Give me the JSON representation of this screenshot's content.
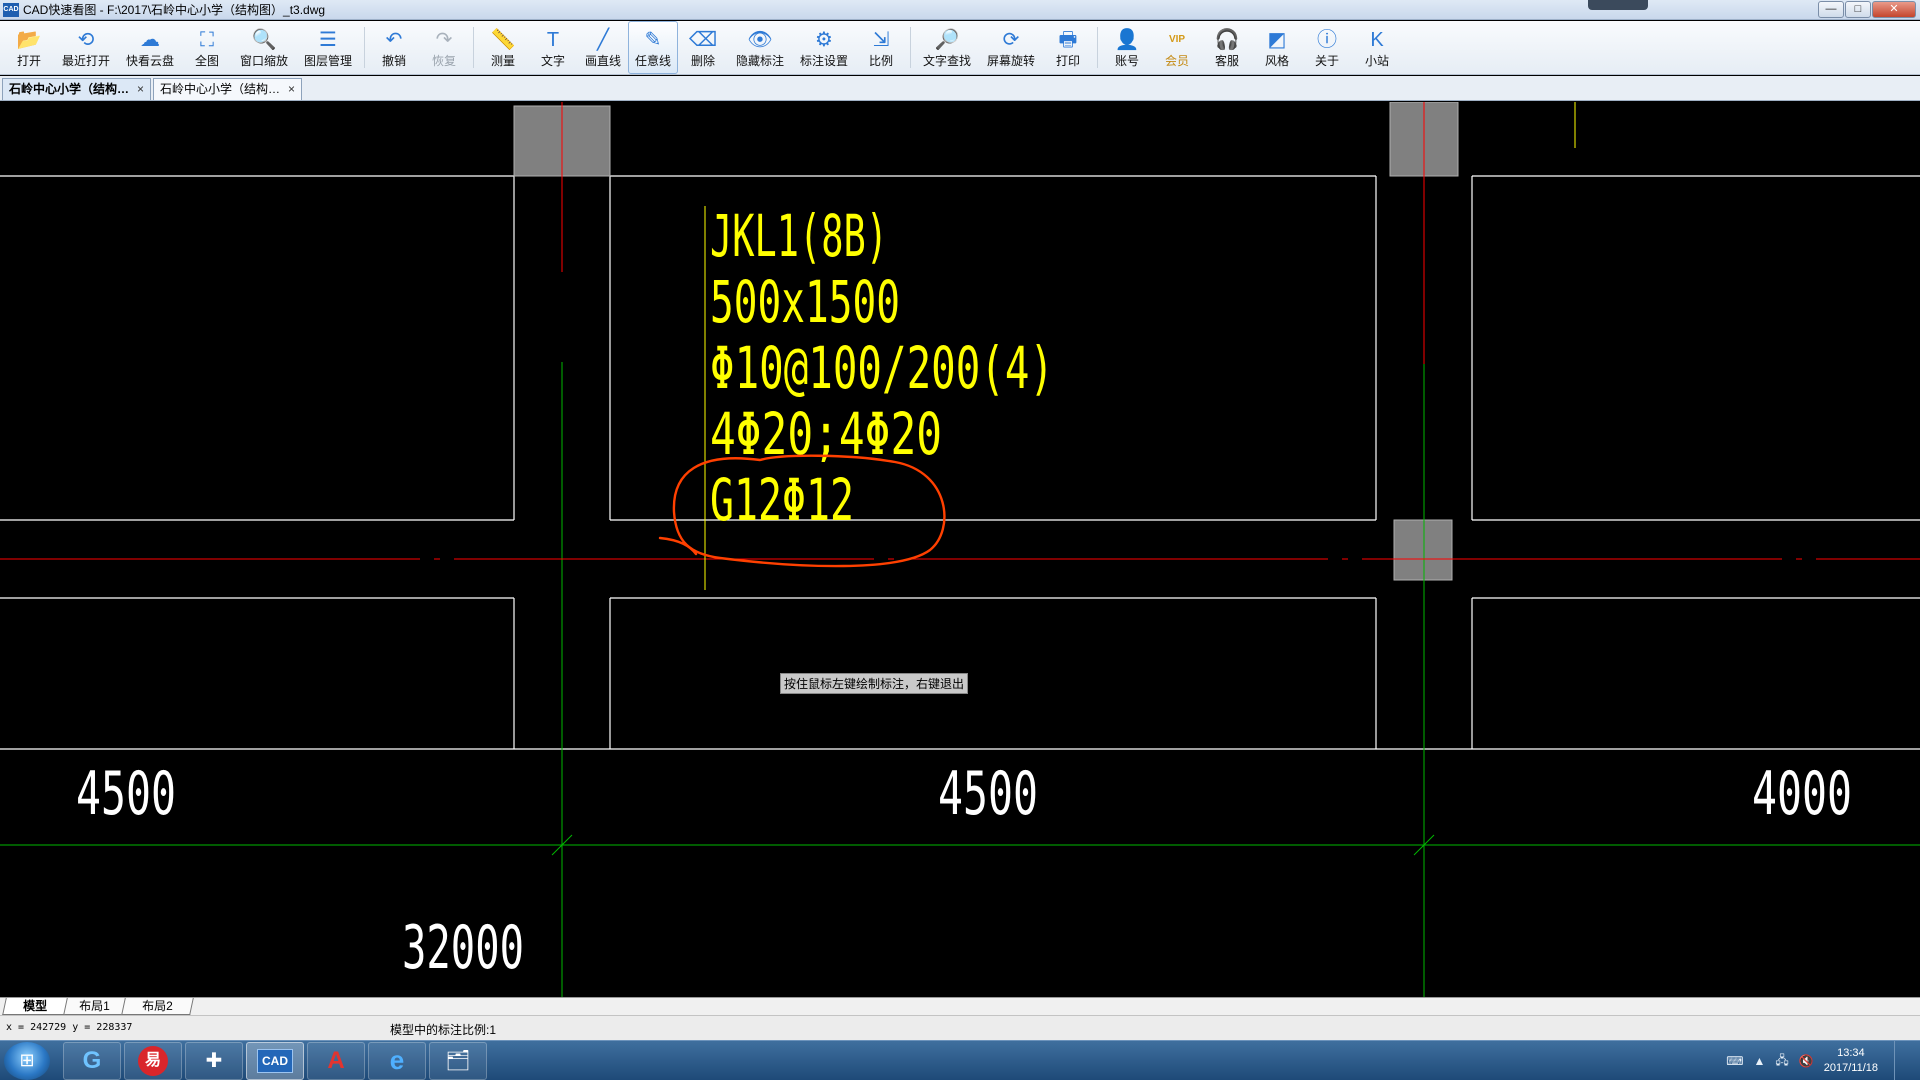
{
  "window": {
    "app_icon": "CAD",
    "title": "CAD快速看图 - F:\\2017\\石岭中心小学（结构图）_t3.dwg",
    "buttons": {
      "minimize": "—",
      "maximize": "□",
      "close": "✕"
    }
  },
  "toolbar": {
    "items": [
      {
        "id": "open",
        "label": "打开",
        "icon": "folder-open-icon",
        "glyph": "📂"
      },
      {
        "id": "recent",
        "label": "最近打开",
        "icon": "history-icon",
        "glyph": "⟲"
      },
      {
        "id": "cloud",
        "label": "快看云盘",
        "icon": "cloud-icon",
        "glyph": "☁"
      },
      {
        "id": "fullview",
        "label": "全图",
        "icon": "fullscreen-icon",
        "glyph": "⛶"
      },
      {
        "id": "zoomwin",
        "label": "窗口缩放",
        "icon": "zoom-window-icon",
        "glyph": "🔍"
      },
      {
        "id": "layers",
        "label": "图层管理",
        "icon": "layers-icon",
        "glyph": "☰"
      },
      {
        "id": "undo",
        "label": "撤销",
        "icon": "undo-icon",
        "glyph": "↶"
      },
      {
        "id": "redo",
        "label": "恢复",
        "icon": "redo-icon",
        "glyph": "↷",
        "disabled": true
      },
      {
        "id": "measure",
        "label": "测量",
        "icon": "ruler-icon",
        "glyph": "📏"
      },
      {
        "id": "text",
        "label": "文字",
        "icon": "text-tool-icon",
        "glyph": "T"
      },
      {
        "id": "line",
        "label": "画直线",
        "icon": "line-tool-icon",
        "glyph": "╱"
      },
      {
        "id": "freeline",
        "label": "任意线",
        "icon": "pen-icon",
        "glyph": "✎",
        "active": true
      },
      {
        "id": "erase",
        "label": "删除",
        "icon": "eraser-icon",
        "glyph": "⌫"
      },
      {
        "id": "hidemark",
        "label": "隐藏标注",
        "icon": "eye-hidden-icon",
        "glyph": "👁"
      },
      {
        "id": "marksettings",
        "label": "标注设置",
        "icon": "markup-settings-icon",
        "glyph": "⚙"
      },
      {
        "id": "scale",
        "label": "比例",
        "icon": "scale-icon",
        "glyph": "⇲"
      },
      {
        "id": "findtext",
        "label": "文字查找",
        "icon": "text-search-icon",
        "glyph": "🔎"
      },
      {
        "id": "rotate",
        "label": "屏幕旋转",
        "icon": "rotate-screen-icon",
        "glyph": "⟳"
      },
      {
        "id": "print",
        "label": "打印",
        "icon": "printer-icon",
        "glyph": "🖶"
      },
      {
        "id": "account",
        "label": "账号",
        "icon": "user-icon",
        "glyph": "👤"
      },
      {
        "id": "vip",
        "label": "会员",
        "icon": "vip-icon",
        "glyph": "VIP",
        "vip": true
      },
      {
        "id": "support",
        "label": "客服",
        "icon": "headset-icon",
        "glyph": "🎧"
      },
      {
        "id": "style",
        "label": "风格",
        "icon": "style-icon",
        "glyph": "◩"
      },
      {
        "id": "about",
        "label": "关于",
        "icon": "info-icon",
        "glyph": "ⓘ"
      },
      {
        "id": "station",
        "label": "小站",
        "icon": "kuaikan-station-icon",
        "glyph": "K"
      }
    ]
  },
  "doc_tabs": [
    {
      "label": "石岭中心小学（结构…",
      "close": "×",
      "active": true
    },
    {
      "label": "石岭中心小学（结构…",
      "close": "×",
      "active": false
    }
  ],
  "drawing": {
    "colors": {
      "outline": "#ffffff",
      "axis_red": "#ff0000",
      "axis_green": "#00b800",
      "annotation": "#ffff00",
      "dimension": "#ffffff",
      "markup": "#ff4000",
      "column": "#808080"
    },
    "beam_label": {
      "name": "JKL1(8B)",
      "section": "500x1500",
      "stirrup": "Φ10@100/200(4)",
      "longitudinal": "4Φ20;4Φ20",
      "side_bars": "G12Φ12"
    },
    "dimensions": {
      "span_left": "4500",
      "span_mid": "4500",
      "span_right": "4000",
      "total": "32000"
    },
    "tooltip": "按住鼠标左键绘制标注，右键退出"
  },
  "layout_tabs": [
    {
      "label": "模型",
      "active": true
    },
    {
      "label": "布局1",
      "active": false
    },
    {
      "label": "布局2",
      "active": false
    }
  ],
  "status": {
    "coords": "x = 242729  y = 228337",
    "scale": "模型中的标注比例:1"
  },
  "taskbar": {
    "apps": [
      {
        "id": "browser360",
        "icon": "360-browser-icon",
        "glyph": "G"
      },
      {
        "id": "netease",
        "icon": "netease-music-icon",
        "glyph": "易"
      },
      {
        "id": "qqsync",
        "icon": "sync-app-icon",
        "glyph": "✚"
      },
      {
        "id": "cadviewer",
        "icon": "cad-viewer-icon",
        "glyph": "CAD",
        "active": true
      },
      {
        "id": "autocad",
        "icon": "autocad-icon",
        "glyph": "A"
      },
      {
        "id": "ie",
        "icon": "internet-explorer-icon",
        "glyph": "e"
      },
      {
        "id": "explorer",
        "icon": "file-explorer-icon",
        "glyph": "🗂"
      }
    ],
    "clock": {
      "time": "13:34",
      "date": "2017/11/18"
    }
  }
}
